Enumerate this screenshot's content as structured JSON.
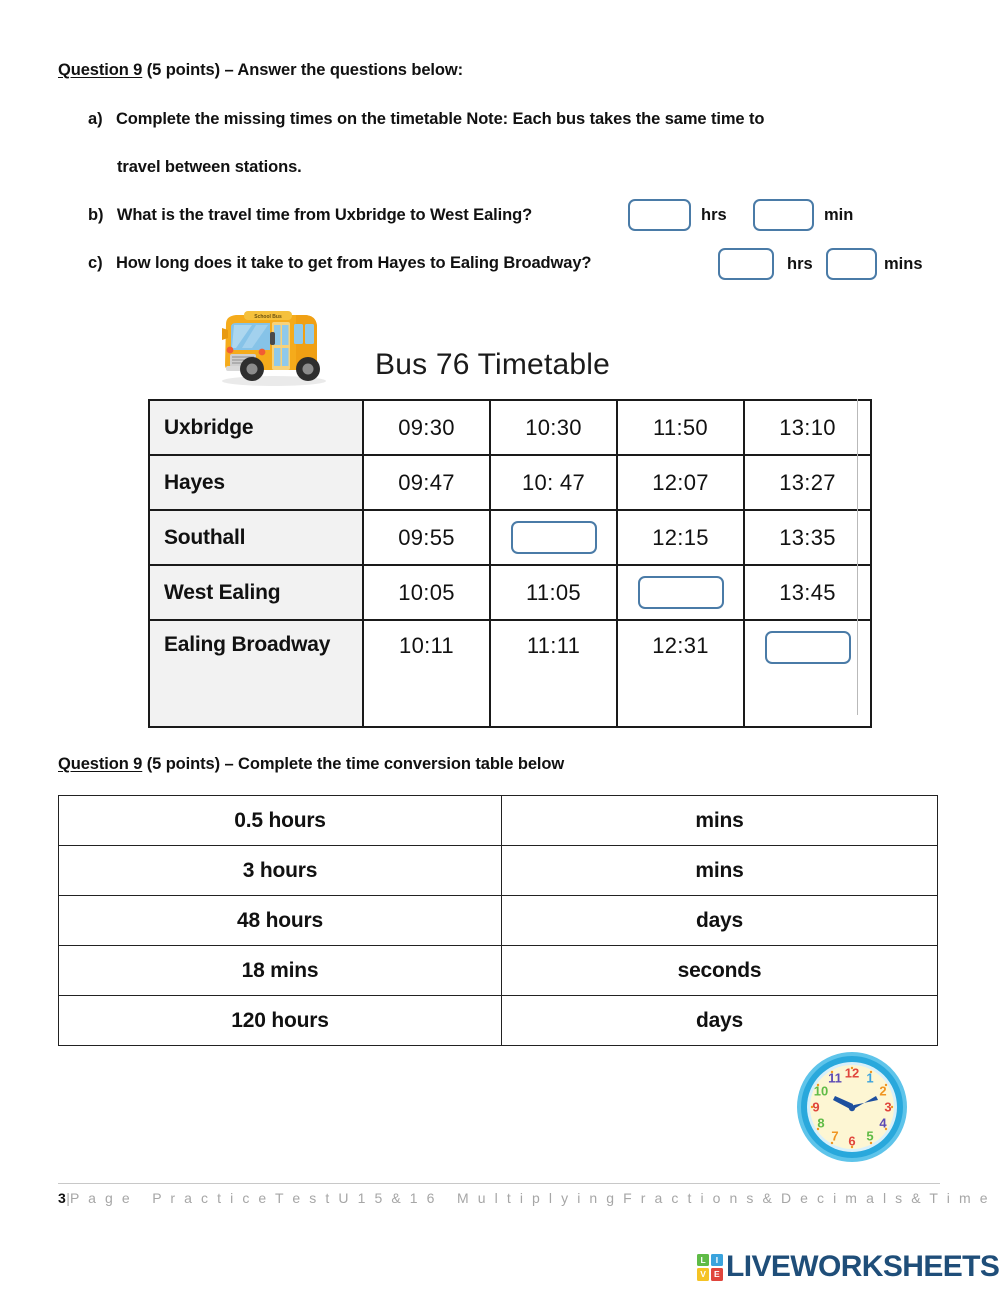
{
  "question_a_block": {
    "heading_label": "Question 9",
    "heading_rest": " (5 points) – Answer the questions below:",
    "item_a_marker": "a)",
    "item_a_line1": "Complete the missing times on the timetable Note: Each bus takes the same time to",
    "item_a_line2": "travel between stations.",
    "item_b_marker": "b)",
    "item_b_text": "What is the travel time from Uxbridge to West Ealing?",
    "item_b_unit1": "hrs",
    "item_b_unit2": "min",
    "item_b_answer1": "",
    "item_b_answer2": "",
    "item_c_marker": "c)",
    "item_c_text": "How long does it take to get from Hayes to Ealing Broadway?",
    "item_c_unit1": "hrs",
    "item_c_unit2": "mins",
    "item_c_answer1": "",
    "item_c_answer2": ""
  },
  "timetable": {
    "title": "Bus 76 Timetable",
    "bus_icon": "school-bus-icon",
    "bus_sign_text": "School Bus",
    "rows": [
      {
        "station": "Uxbridge",
        "times": [
          "09:30",
          "10:30",
          "11:50",
          "13:10"
        ]
      },
      {
        "station": "Hayes",
        "times": [
          "09:47",
          "10: 47",
          "12:07",
          "13:27"
        ]
      },
      {
        "station": "Southall",
        "times": [
          "09:55",
          "",
          "12:15",
          "13:35"
        ]
      },
      {
        "station": "West Ealing",
        "times": [
          "10:05",
          "11:05",
          "",
          "13:45"
        ]
      },
      {
        "station": "Ealing Broadway",
        "times": [
          "10:11",
          "11:11",
          "12:31",
          ""
        ]
      }
    ],
    "blank_cells": [
      {
        "row": 2,
        "col": 1
      },
      {
        "row": 3,
        "col": 2
      },
      {
        "row": 4,
        "col": 3
      }
    ]
  },
  "question_b_block": {
    "heading_label": "Question 9",
    "heading_rest": " (5 points) – Complete the time conversion table below"
  },
  "conversion_table": {
    "rows": [
      {
        "from": "0.5 hours",
        "to": "mins"
      },
      {
        "from": "3 hours",
        "to": "mins"
      },
      {
        "from": "48 hours",
        "to": "days"
      },
      {
        "from": "18 mins",
        "to": "seconds"
      },
      {
        "from": "120 hours",
        "to": "days"
      }
    ]
  },
  "clock": {
    "icon": "analog-clock-icon",
    "numbers": [
      "12",
      "1",
      "2",
      "3",
      "4",
      "5",
      "6",
      "7",
      "8",
      "9",
      "10",
      "11"
    ],
    "rim_color": "#29a8dc",
    "face_color": "#fdf6d3",
    "hand_color": "#1d4f9e"
  },
  "footer": {
    "page_number": "3",
    "page_word": "P a g e",
    "doc_title": "P r a c t i c e   T e s t   U 1 5 & 1 6",
    "doc_subtitle": "M u l t i p l y i n g   F r a c t i o n s   &   D e c i m a l s   &   T i m e"
  },
  "brand": {
    "wordmark": "LIVEWORKSHEETS",
    "mark_letters": [
      "L",
      "I",
      "V",
      "E"
    ],
    "mark_colors": [
      "#5fbb46",
      "#3aa3dd",
      "#f5c325",
      "#e0453c"
    ],
    "wordmark_color": "#1f4e79"
  }
}
